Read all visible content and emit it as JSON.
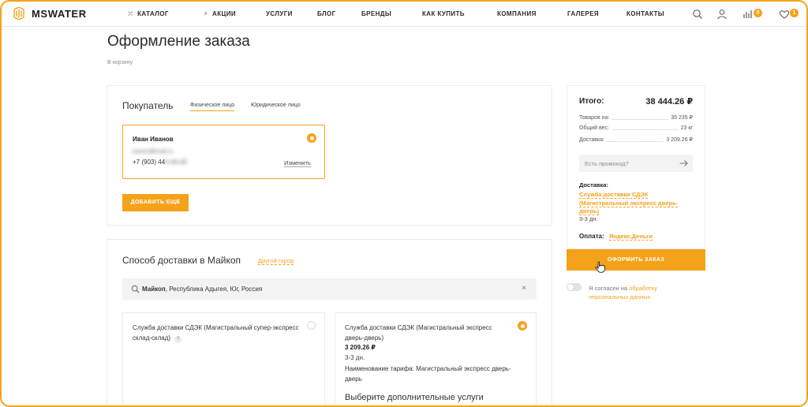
{
  "header": {
    "logo_text": "MSWATER",
    "nav": [
      {
        "label": "КАТАЛОГ",
        "icon": "grid-icon"
      },
      {
        "label": "АКЦИИ",
        "icon": "lightning-icon"
      },
      {
        "label": "УСЛУГИ"
      },
      {
        "label": "БЛОГ"
      },
      {
        "label": "БРЕНДЫ"
      },
      {
        "label": "КАК КУПИТЬ"
      },
      {
        "label": "КОМПАНИЯ"
      },
      {
        "label": "ГАЛЕРЕЯ"
      },
      {
        "label": "КОНТАКТЫ"
      }
    ],
    "compare_count": "0",
    "favorites_count": "1",
    "accent": "#f5a21b"
  },
  "page": {
    "title": "Оформление заказа",
    "breadcrumb": "В корзину"
  },
  "buyer": {
    "title": "Покупатель",
    "tabs": [
      "Физическое лицо",
      "Юридическое лицо"
    ],
    "name": "Иван Иванов",
    "email_masked": "ivanov@mail.ru",
    "phone_visible": "+7 (903) 44",
    "phone_masked": "4-44-44",
    "edit_label": "Изменить",
    "add_button": "ДОБАВИТЬ ЕЩЕ"
  },
  "delivery": {
    "title": "Способ доставки в Майкоп",
    "other_city": "Другой город",
    "city_bold": "Майкоп",
    "city_rest": ", Республика Адыгея, Юг, Россия",
    "options": [
      {
        "name": "Служба доставки СДЭК (Магистральный супер-экспресс склад-склад)",
        "help": "?"
      },
      {
        "name": "Служба доставки СДЭК (Магистральный экспресс дверь-дверь)",
        "price": "3 209.26 ₽",
        "days": "3-3 дн.",
        "tariff": "Наименование тарифа: Магистральный экспресс дверь-дверь",
        "extras_title": "Выберите дополнительные услуги"
      }
    ]
  },
  "summary": {
    "total_label": "Итого:",
    "total_value": "38 444.26 ₽",
    "rows": [
      {
        "label": "Товаров на:",
        "value": "35 235 ₽"
      },
      {
        "label": "Общий вес:",
        "value": "23 кг"
      },
      {
        "label": "Доставка:",
        "value": "3 209.26 ₽"
      }
    ],
    "promo_placeholder": "Есть промокод?",
    "delivery_label": "Доставка:",
    "delivery_value": "Служба доставки СДЭК (Магистральный экспресс дверь-дверь)",
    "delivery_days": "3-3 дн.",
    "payment_label": "Оплата:",
    "payment_value": "Яндекс.Деньги",
    "submit_button": "ОФОРМИТЬ ЗАКАЗ",
    "consent_text": "Я согласен на",
    "consent_link": "обработку персональных данных"
  }
}
